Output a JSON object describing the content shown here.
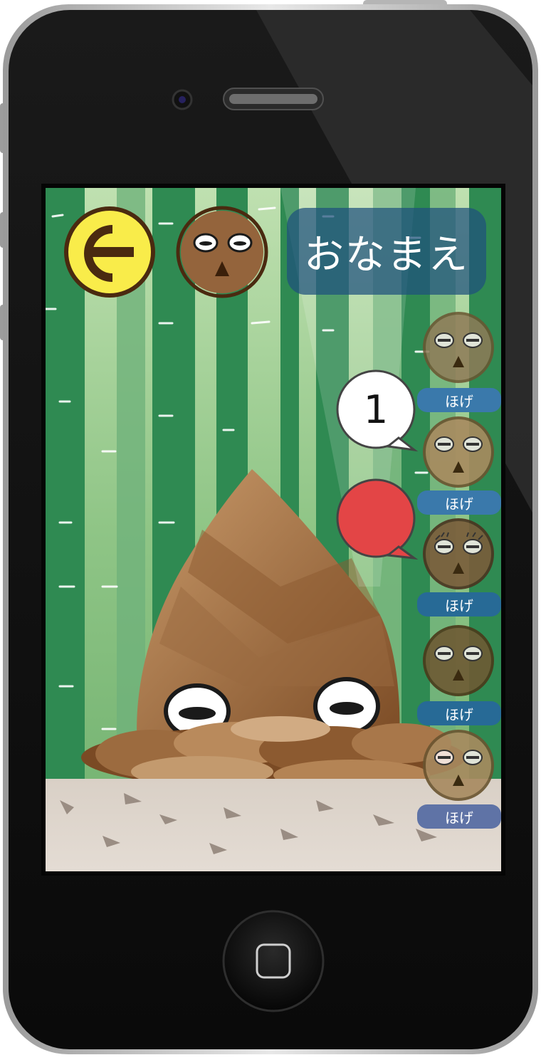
{
  "header": {
    "name_title": "おなまえ"
  },
  "speech": {
    "count": "1"
  },
  "characters": [
    {
      "label": "ほげ",
      "color": "#3a79ab"
    },
    {
      "label": "ほげ",
      "color": "#3a79ab"
    },
    {
      "label": "ほげ",
      "color": "#276a96"
    },
    {
      "label": "ほげ",
      "color": "#276a96"
    },
    {
      "label": "ほげ",
      "color": "#5f73a6"
    }
  ],
  "colors": {
    "back_button": "#f9ec4a",
    "accent_brown": "#4a2a10",
    "speech_red": "#e34546"
  },
  "icons": {
    "back": "back-arrow-icon",
    "avatar": "takenoko-face-icon",
    "home": "home-button-icon"
  }
}
